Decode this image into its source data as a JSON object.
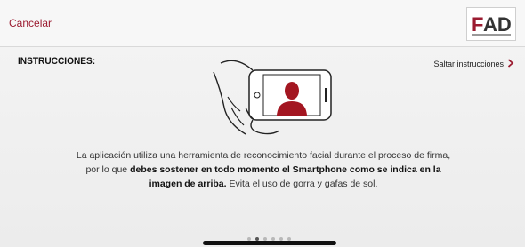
{
  "header": {
    "cancel_label": "Cancelar",
    "logo_text": "FAD"
  },
  "instructions": {
    "title": "INSTRUCCIONES:",
    "skip_label": "Saltar instrucciones",
    "paragraph": {
      "part1": "La aplicación utiliza una herramienta de reconocimiento facial durante el proceso de firma, por lo que ",
      "bold1": "debes sostener en todo momento el Smartphone como se indica en la imagen de arriba.",
      "part2": " Evita el uso de gorra y gafas de sol."
    }
  },
  "pagination": {
    "count": 6,
    "active_index": 1
  },
  "colors": {
    "accent": "#9b1b30",
    "silhouette": "#a31621"
  },
  "icons": [
    "chevron-right-icon",
    "hand-holding-phone-icon",
    "person-silhouette-icon"
  ]
}
